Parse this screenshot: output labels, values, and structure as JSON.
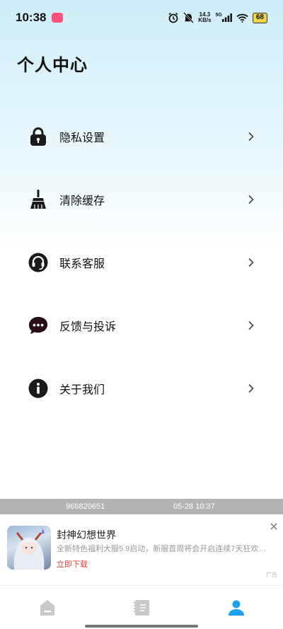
{
  "status_bar": {
    "time": "10:38",
    "net_speed_value": "14.3",
    "net_speed_unit": "KB/s",
    "signal_label": "5G",
    "battery": "68"
  },
  "page": {
    "title": "个人中心"
  },
  "menu": {
    "items": [
      {
        "label": "隐私设置",
        "icon": "lock-icon"
      },
      {
        "label": "清除缓存",
        "icon": "broom-icon"
      },
      {
        "label": "联系客服",
        "icon": "customer-service-icon"
      },
      {
        "label": "反馈与投诉",
        "icon": "chat-bubble-icon"
      },
      {
        "label": "关于我们",
        "icon": "info-icon"
      }
    ]
  },
  "info_bar": {
    "id": "966820651",
    "datetime": "05-28 10:37"
  },
  "ad": {
    "title": "封神幻想世界",
    "description": "全新特色福利大服5.9启动，新服首周将会开启连续7天狂欢…",
    "cta": "立即下载",
    "tag": "广告"
  },
  "tab_bar": {
    "tabs": [
      {
        "icon": "home-icon",
        "active": false
      },
      {
        "icon": "poem-icon",
        "active": false
      },
      {
        "icon": "user-icon",
        "active": true
      }
    ]
  },
  "colors": {
    "accent": "#1aa3ee",
    "ad_cta": "#e0403a",
    "icon_dark": "#1a1a1a",
    "chat_icon": "#2a0f16"
  }
}
